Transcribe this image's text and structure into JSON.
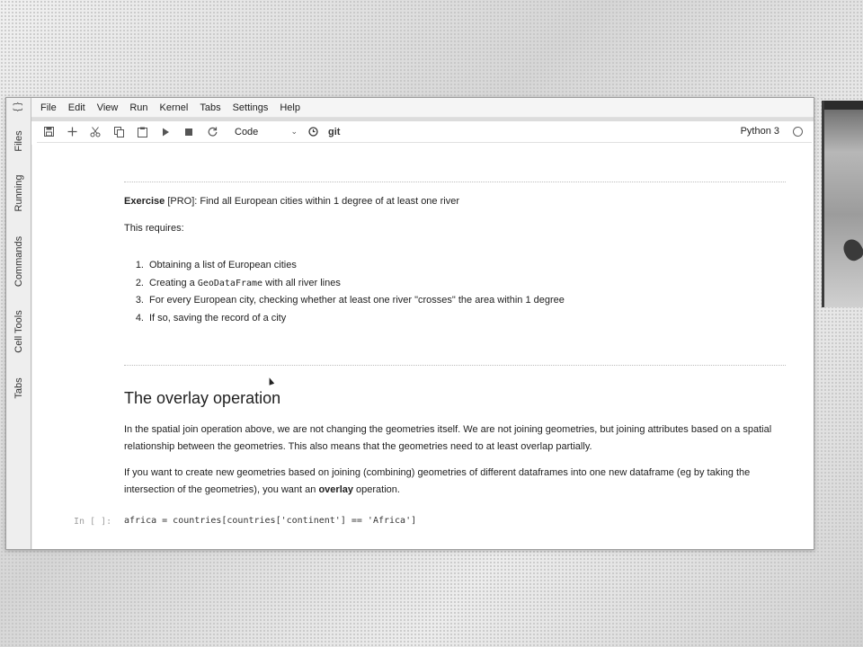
{
  "menubar": {
    "items": [
      "File",
      "Edit",
      "View",
      "Run",
      "Kernel",
      "Tabs",
      "Settings",
      "Help"
    ]
  },
  "sidebar": {
    "top_icon": "{ }",
    "tabs": [
      "Files",
      "Running",
      "Commands",
      "Cell Tools",
      "Tabs"
    ]
  },
  "toolbar": {
    "icons": [
      "save-icon",
      "add-cell-icon",
      "cut-icon",
      "copy-icon",
      "paste-icon",
      "run-icon",
      "stop-icon",
      "restart-icon"
    ],
    "cell_type": "Code",
    "git_label": "git",
    "kernel_name": "Python 3"
  },
  "exercise": {
    "label": "Exercise",
    "text": " [PRO]: Find all European cities within 1 degree of at least one river",
    "requires": "This requires:",
    "steps": [
      {
        "num": "1.",
        "pre": "Obtaining a list of European cities",
        "code": "",
        "post": ""
      },
      {
        "num": "2.",
        "pre": "Creating a ",
        "code": "GeoDataFrame",
        "post": " with all river lines"
      },
      {
        "num": "3.",
        "pre": "For every European city, checking whether at least one river \"crosses\" the area within 1 degree",
        "code": "",
        "post": ""
      },
      {
        "num": "4.",
        "pre": "If so, saving the record of a city",
        "code": "",
        "post": ""
      }
    ]
  },
  "overlay_section": {
    "heading": "The overlay operation",
    "para1": "In the spatial join operation above, we are not changing the geometries itself. We are not joining geometries, but joining attributes based on a spatial relationship between the geometries. This also means that the geometries need to at least overlap partially.",
    "para2_pre": "If you want to create new geometries based on joining (combining) geometries of different dataframes into one new dataframe (eg by taking the intersection of the geometries), you want an ",
    "para2_bold": "overlay",
    "para2_post": " operation."
  },
  "code_cell": {
    "prompt": "In [ ]:",
    "source": "africa = countries[countries['continent'] == 'Africa']"
  }
}
